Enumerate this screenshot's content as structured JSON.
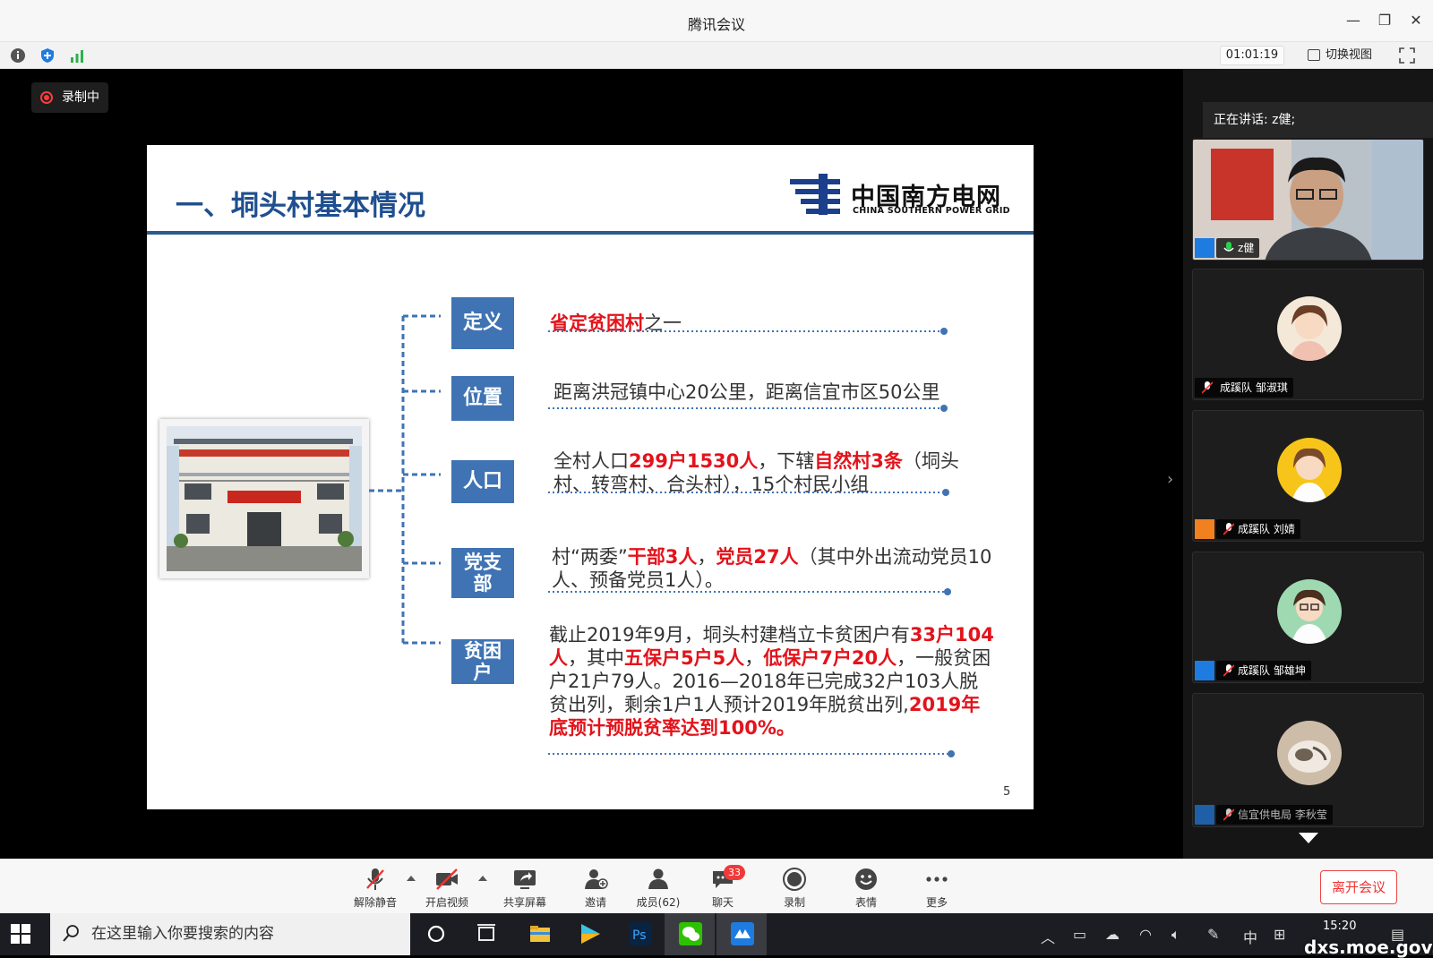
{
  "window": {
    "title": "腾讯会议"
  },
  "toolbar": {
    "timer": "01:01:19",
    "switch_view": "切换视图"
  },
  "recording_badge": "录制中",
  "slide": {
    "title": "一、垌头村基本情况",
    "logo_cn": "中国南方电网",
    "logo_en": "CHINA SOUTHERN POWER GRID",
    "page_number": "5",
    "rows": [
      {
        "tag": "定义",
        "text_red": "省定贫困村",
        "text_rest": "之一"
      },
      {
        "tag": "位置",
        "text": "距离洪冠镇中心20公里，距离信宜市区50公里"
      },
      {
        "tag": "人口",
        "t1": "全村人口",
        "r1": "299户1530人",
        "t2": "，下辖",
        "r2": "自然村3条",
        "t3": "（垌头村、转弯村、合头村），15个村民小组"
      },
      {
        "tag": "党支部",
        "t1": "村“两委”",
        "r1": "干部3人",
        "t2": "，",
        "r2": "党员27人",
        "t3": "（其中外出流动党员10人、预备党员1人）。"
      },
      {
        "tag": "贫困户",
        "t1": "截止2019年9月，垌头村建档立卡贫困户有",
        "r1": "33户104人",
        "t2": "，其中",
        "r2": "五保户5户5人",
        "t3": "，",
        "r3": "低保户7户20人",
        "t4": "，一般贫困户21户79人。2016—2018年已完成32户103人脱贫出列，剩余1户1人预计2019年脱贫出列,",
        "r4": "2019年底预计预脱贫率达到100%。"
      }
    ]
  },
  "sidebar": {
    "speaking": "正在讲话: z健;",
    "participants": [
      {
        "name": "z健"
      },
      {
        "name": "成蹊队 邹淑琪"
      },
      {
        "name": "成蹊队 刘婧"
      },
      {
        "name": "成蹊队 邹雄坤"
      },
      {
        "name": "信宜供电局 李秋莹"
      }
    ]
  },
  "bottombar": {
    "unmute": "解除静音",
    "video": "开启视频",
    "share": "共享屏幕",
    "invite": "邀请",
    "members": "成员(62)",
    "chat": "聊天",
    "chat_badge": "33",
    "record": "录制",
    "emoji": "表情",
    "more": "更多",
    "leave": "离开会议"
  },
  "taskbar": {
    "search_placeholder": "在这里输入你要搜索的内容",
    "ime": "中",
    "time": "15:20",
    "watermark": "dxs.moe.gov.cn"
  }
}
